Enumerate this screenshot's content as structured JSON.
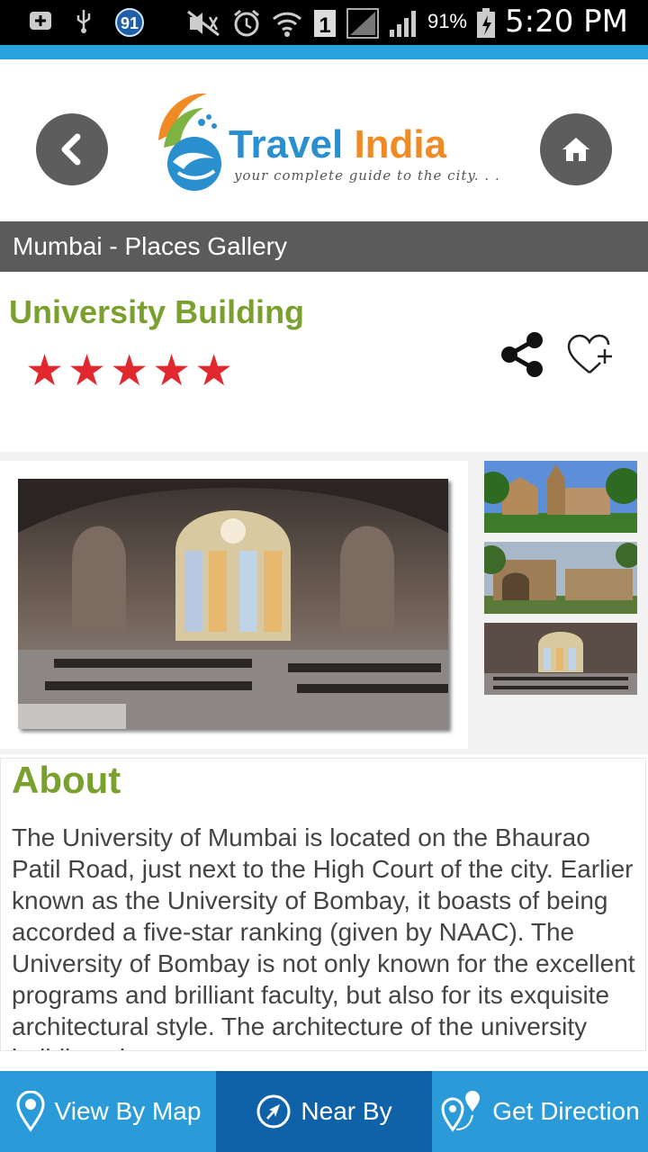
{
  "status_bar": {
    "notification_badge": "91",
    "sim_badge": "1",
    "battery_percent": "91%",
    "time": "5:20 PM",
    "icons": [
      "plus-box-icon",
      "usb-icon",
      "badge-icon",
      "mute-icon",
      "alarm-icon",
      "wifi-icon",
      "sim-icon",
      "signal-icon",
      "signal-icon",
      "battery-icon"
    ]
  },
  "colors": {
    "accent": "#29a3de",
    "title_green": "#7aa02e",
    "star_red": "#e0282e",
    "nav_blue": "#2a9bd8",
    "nav_dark_blue": "#0f62a8",
    "section_gray": "#5b5b5b"
  },
  "header": {
    "logo_word1": "Travel",
    "logo_word2": "India",
    "logo_tagline": "your complete guide to the city. . .",
    "back_icon": "chevron-left-icon",
    "home_icon": "home-icon"
  },
  "section": {
    "title": "Mumbai - Places Gallery"
  },
  "place": {
    "title": "University Building",
    "rating": 5,
    "rating_max": 5,
    "share_icon": "share-icon",
    "favorite_icon": "heart-plus-icon"
  },
  "about": {
    "heading": "About",
    "text": "The University of Mumbai is located on the Bhaurao Patil Road, just next to the High Court of the city. Earlier known as the University of Bombay, it boasts of being accorded a five-star ranking (given by NAAC). The University of Bombay is not only known for the excellent programs and brilliant faculty, but also for its exquisite architectural style. The architecture of the university building also"
  },
  "bottom_nav": {
    "map_label": "View By Map",
    "nearby_label": "Near By",
    "direction_label": "Get Direction"
  }
}
